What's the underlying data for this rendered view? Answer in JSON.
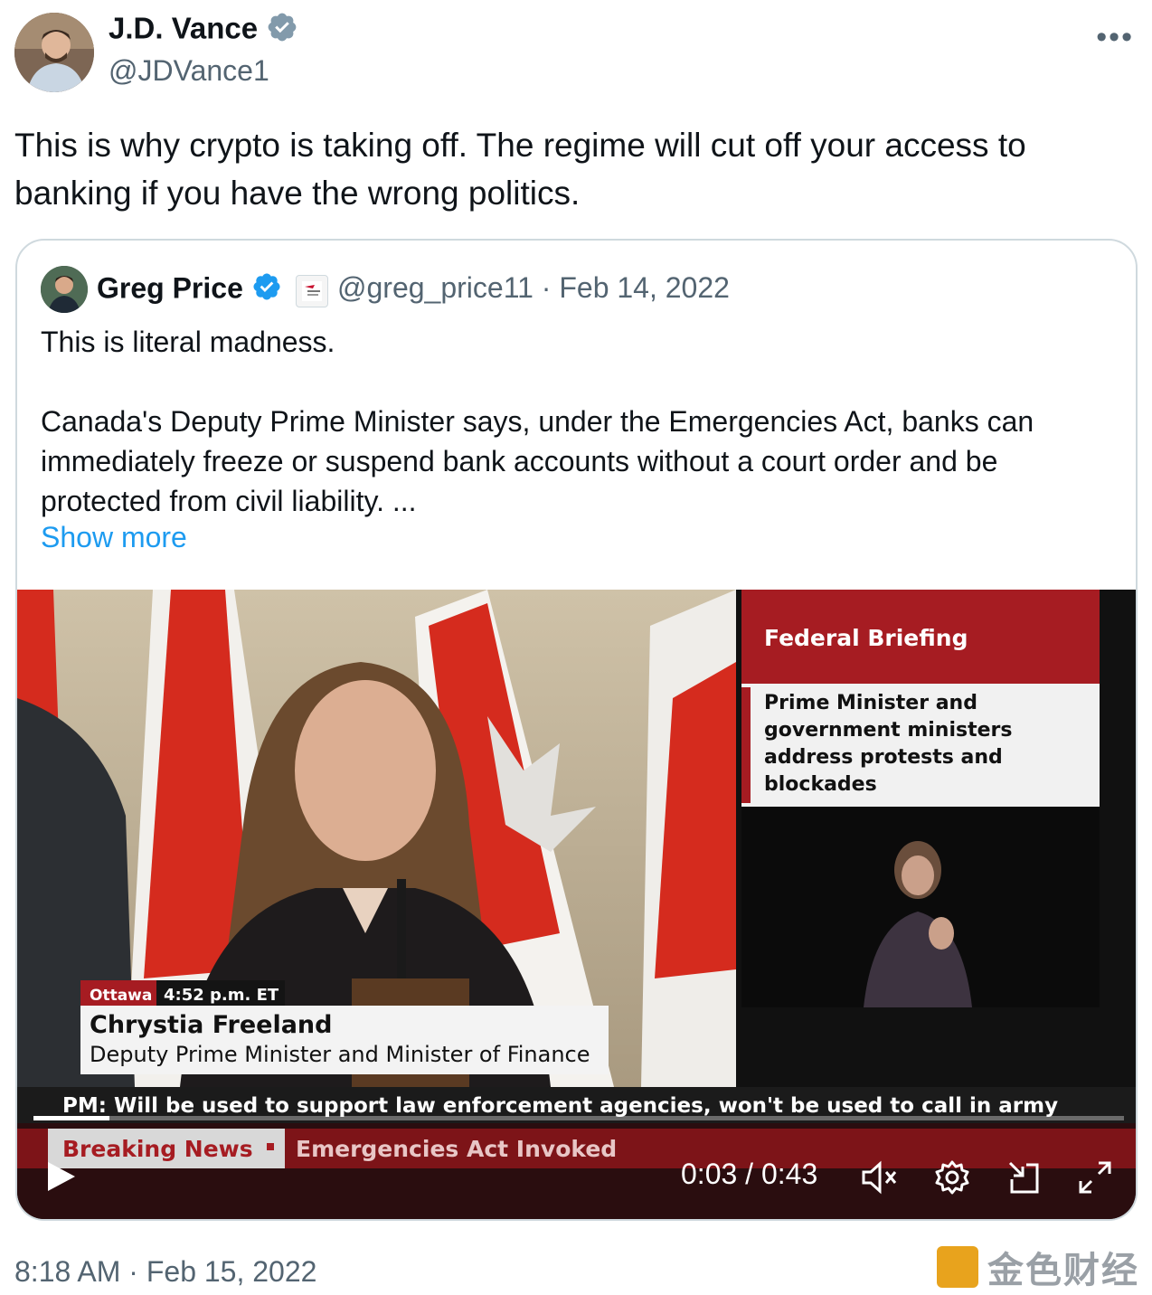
{
  "tweet": {
    "author_name": "J.D. Vance",
    "author_handle": "@JDVance1",
    "text": "This is why crypto is taking off. The regime will cut off your access to banking if you have the wrong politics.",
    "timestamp": "8:18 AM · Feb 15, 2022",
    "more_icon": "more-horizontal-icon"
  },
  "quote": {
    "author_name": "Greg Price",
    "handle_date": "@greg_price11 · Feb 14, 2022",
    "text": "This is literal madness.\n\nCanada's Deputy Prime Minister says, under the Emergencies Act, banks can immediately freeze or suspend bank accounts without a court order and be protected from civil liability. ...",
    "show_more": "Show more"
  },
  "video": {
    "panel_title": "Federal Briefing",
    "panel_subtitle": "Prime Minister and government ministers address protests and blockades",
    "location": "Ottawa",
    "time": "4:52 p.m. ET",
    "speaker_name": "Chrystia Freeland",
    "speaker_title": "Deputy Prime Minister and Minister of Finance",
    "ticker": "PM: Will be used to support law enforcement agencies, won't be used to call in army",
    "breaking_label": "Breaking News",
    "breaking_text": "Emergencies Act Invoked",
    "time_display": "0:03 / 0:43",
    "progress": 0.07
  },
  "watermark": {
    "text": "金色财经"
  },
  "colors": {
    "accent": "#1d9bf0",
    "news_red": "#b01e23",
    "secondary_text": "#536471"
  }
}
